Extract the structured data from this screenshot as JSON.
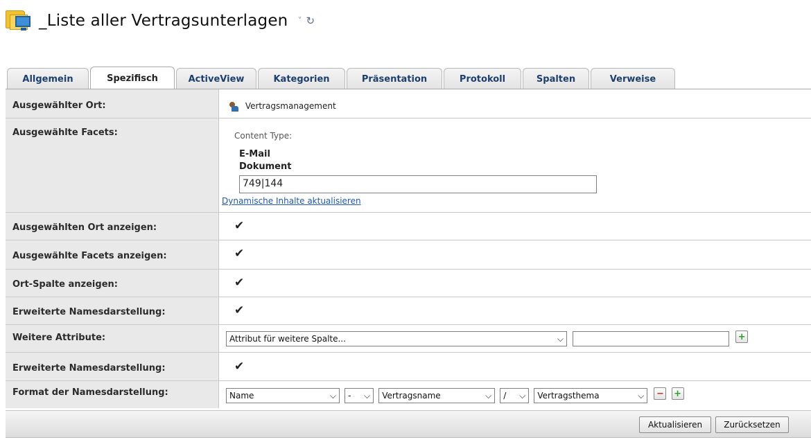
{
  "header": {
    "title": "_Liste aller Vertragsunterlagen",
    "chevron": "˅",
    "refresh": "↻",
    "icon": "folder-monitor-icon"
  },
  "tabs": [
    {
      "label": "Allgemein",
      "active": false
    },
    {
      "label": "Spezifisch",
      "active": true
    },
    {
      "label": "ActiveView",
      "active": false
    },
    {
      "label": "Kategorien",
      "active": false
    },
    {
      "label": "Präsentation",
      "active": false
    },
    {
      "label": "Protokoll",
      "active": false
    },
    {
      "label": "Spalten",
      "active": false
    },
    {
      "label": "Verweise",
      "active": false
    }
  ],
  "form": {
    "location": {
      "label": "Ausgewählter Ort:",
      "value": "Vertragsmanagement"
    },
    "facets": {
      "label": "Ausgewählte Facets:",
      "content_type_label": "Content Type:",
      "types": [
        "E-Mail",
        "Dokument"
      ],
      "input_value": "749|144",
      "refresh_link": "Dynamische Inhalte aktualisieren"
    },
    "show_location": {
      "label": "Ausgewählten Ort anzeigen:",
      "checked": true
    },
    "show_facets": {
      "label": "Ausgewählte Facets anzeigen:",
      "checked": true
    },
    "show_location_column": {
      "label": "Ort-Spalte anzeigen:",
      "checked": true
    },
    "extended_naming_1": {
      "label": "Erweiterte Namesdarstellung:",
      "checked": true
    },
    "more_attributes": {
      "label": "Weitere Attribute:",
      "select_value": "Attribut für weitere Spalte...",
      "input_value": ""
    },
    "extended_naming_2": {
      "label": "Erweiterte Namesdarstellung:",
      "checked": true
    },
    "name_format": {
      "label": "Format der Namesdarstellung:",
      "select_1": "Name",
      "separator_1": "-",
      "select_2": "Vertragsname",
      "separator_2": "/",
      "select_3": "Vertragsthema"
    }
  },
  "glyphs": {
    "check": "✔",
    "chevron": "⌵",
    "plus": "+",
    "minus": "−"
  },
  "footer": {
    "update_button": "Aktualisieren",
    "reset_button": "Zurücksetzen"
  },
  "colors": {
    "link": "#1f58b7",
    "tab_text": "#1c3f6e",
    "label_bg": "#e9e9e9"
  }
}
